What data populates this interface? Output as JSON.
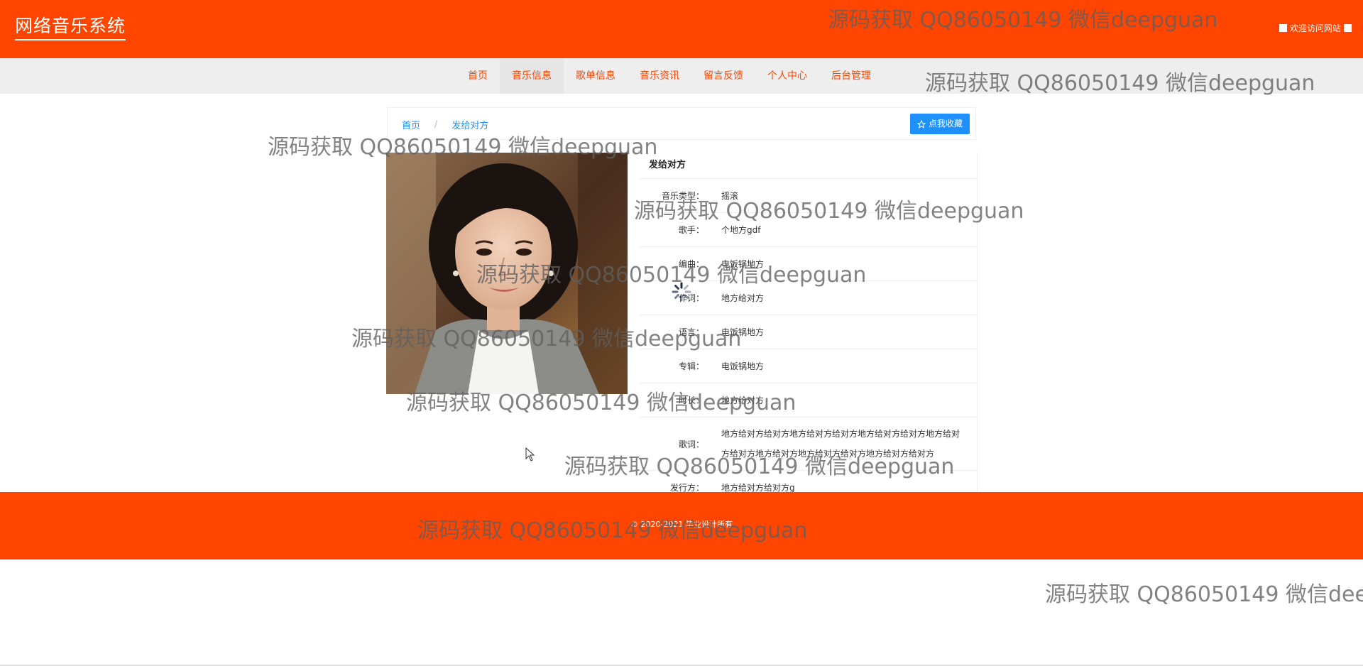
{
  "header": {
    "logo": "网络音乐系统",
    "welcome": "欢迎访问网站"
  },
  "nav": {
    "items": [
      {
        "label": "首页"
      },
      {
        "label": "音乐信息"
      },
      {
        "label": "歌单信息"
      },
      {
        "label": "音乐资讯"
      },
      {
        "label": "留言反馈"
      },
      {
        "label": "个人中心"
      },
      {
        "label": "后台管理"
      }
    ],
    "active_index": 1
  },
  "breadcrumb": {
    "home": "首页",
    "separator": "/",
    "current": "发给对方"
  },
  "collect_button": "点我收藏",
  "detail": {
    "title": "发给对方",
    "rows": [
      {
        "label": "音乐类型：",
        "value": "摇滚"
      },
      {
        "label": "歌手：",
        "value": "个地方gdf"
      },
      {
        "label": "编曲：",
        "value": "电饭锅地方"
      },
      {
        "label": "作词：",
        "value": "地方给对方"
      },
      {
        "label": "语言：",
        "value": "电饭锅地方"
      },
      {
        "label": "专辑：",
        "value": "电饭锅地方"
      },
      {
        "label": "时长：",
        "value": "地方给对方"
      },
      {
        "label": "歌词：",
        "value": "地方给对方给对方地方给对方给对方地方给对方给对方地方给对方给对方地方给对方地方给对方给对方地方给对方给对方"
      },
      {
        "label": "发行方：",
        "value": "地方给对方给对方g"
      }
    ]
  },
  "footer": {
    "copyright": "© 2020-2021 毕业设计所有"
  },
  "watermark": "源码获取 QQ86050149 微信deepguan",
  "colors": {
    "brand": "#FF4500",
    "link": "#1E90FF",
    "nav_bg": "#EEEEEE"
  }
}
